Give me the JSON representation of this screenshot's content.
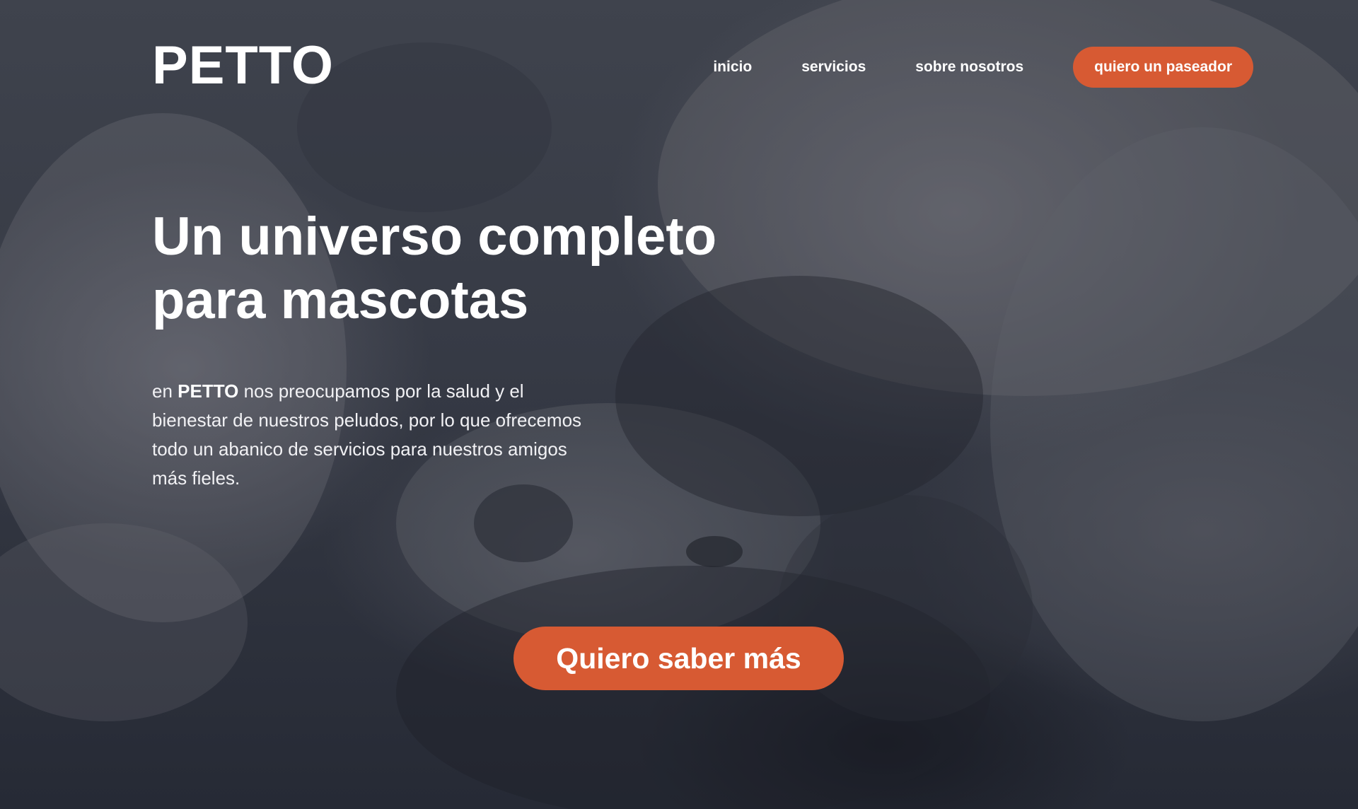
{
  "brand": {
    "logo_text": "PETTO"
  },
  "nav": {
    "items": [
      {
        "label": "inicio"
      },
      {
        "label": "servicios"
      },
      {
        "label": "sobre nosotros"
      }
    ],
    "cta_label": "quiero un paseador"
  },
  "hero": {
    "headline_line1": "Un universo completo",
    "headline_line2": "para mascotas",
    "lead_prefix": "en ",
    "lead_brand": "PETTO",
    "lead_rest": " nos preocupamos por la salud y el bienestar de nuestros peludos, por lo que ofrecemos todo un abanico de servicios para nuestros amigos más fieles.",
    "cta_label": "Quiero saber más"
  },
  "colors": {
    "accent": "#d75a33",
    "overlay": "#2a2f3a",
    "text": "#ffffff"
  }
}
